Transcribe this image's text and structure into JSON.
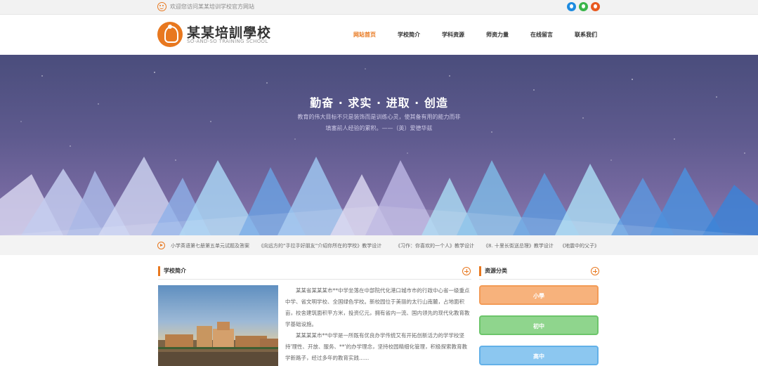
{
  "topbar": {
    "welcome": "欢迎您访问某某培训学校官方网站",
    "icons": [
      "smile-icon",
      "qq-icon",
      "wechat-icon",
      "weibo-icon"
    ]
  },
  "brand": {
    "name_cn": "某某培訓學校",
    "name_en": "SO-AND-SO TRAINING SCHOOL",
    "accent": "#e8781f"
  },
  "nav": {
    "items": [
      "网站首页",
      "学校简介",
      "学科资源",
      "师资力量",
      "在线留言",
      "联系我们"
    ],
    "active": "网站首页"
  },
  "banner": {
    "slogan": "勤奋 · 求实 · 进取 · 创造",
    "quote_line1": "教育的伟大目标不只是装饰而是训练心灵，使其备有用的能力而非",
    "quote_line2": "填塞前人经验的累积。——（英）爱德华兹"
  },
  "ticker": {
    "items": [
      "小学英语第七册第五单元试题及答案",
      "《向远方的“手拉手好朋友”介绍你所在的学校》教学设计",
      "《习作：你喜欢的一个人》教学设计",
      "《8. 十里长街送总理》教学设计",
      "《地震中的父子》"
    ]
  },
  "about": {
    "title": "学校简介",
    "paragraph1": "某某省某某某市**中学坐落在中部院代化港口城市市的行政中心省一级重点中学、省文明学校、全国绿色学校。新校园位于美丽的太行山南麓，占地面积亩，校舍建筑面积平方米，投资亿元，拥有省内一流、国内领先的现代化教育教学基础设施。",
    "paragraph2": "某某某某市**中学是一所既有优良办学传统又有开拓创新活力的学学校坚持'理性、开放、服务、**'的办学理念，坚持校园精细化管理，积极探索教育教学新路子，经过多年的教育实践......"
  },
  "resources": {
    "title": "资源分类",
    "categories": [
      "小學",
      "初中",
      "高中"
    ],
    "colors": [
      "#f7b27c",
      "#8fd58d",
      "#8cc7f0"
    ]
  }
}
